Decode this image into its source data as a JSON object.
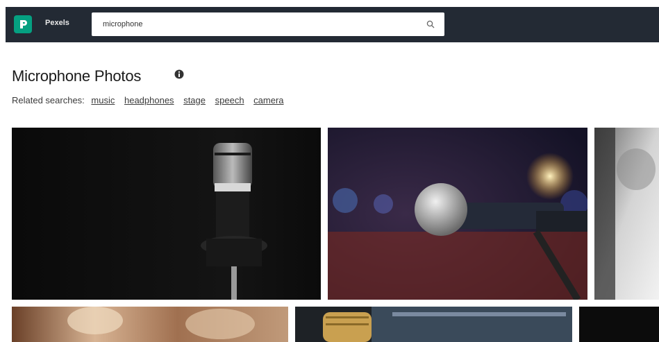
{
  "header": {
    "brand": "Pexels",
    "search_value": "microphone"
  },
  "icons": {
    "logo": "pexels-logo-icon",
    "search": "search-icon",
    "info": "info-icon"
  },
  "page": {
    "title": "Microphone Photos",
    "related_label": "Related searches:",
    "related": [
      "music",
      "headphones",
      "stage",
      "speech",
      "camera"
    ]
  },
  "colors": {
    "topbar": "#232a34",
    "logo": "#05a081"
  }
}
